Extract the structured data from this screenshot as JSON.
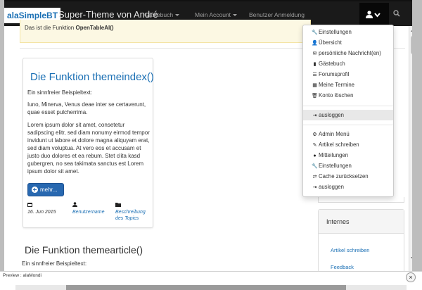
{
  "navbar": {
    "brand_logo": "alaSimpleBT",
    "brand_title": "Super-Theme von André",
    "items": [
      {
        "label": "Gästebuch",
        "has_caret": true
      },
      {
        "label": "Mein Account",
        "has_caret": true
      },
      {
        "label": "Benutzer Anmeldung",
        "has_caret": false
      }
    ],
    "user_icon": "user-icon",
    "search_icon": "search-icon"
  },
  "alert": {
    "prefix": "Das ist die Funktion ",
    "function_name": "OpenTableAl()"
  },
  "card": {
    "title": "Die Funktion themeindex()",
    "intro": "Ein sinnfreier Beispieltext:",
    "para1": "Iuno, Minerva, Venus deae inter se certaverunt, quae esset pulcherrima.",
    "para2": "Lorem ipsum dolor sit amet, consetetur sadipscing elitr, sed diam nonumy eirmod tempor invidunt ut labore et dolore magna aliquyam erat, sed diam voluptua. At vero eos et accusam et justo duo dolores et ea rebum. Stet clita kasd gubergren, no sea takimata sanctus est Lorem ipsum dolor sit amet.",
    "more_button": "mehr...",
    "meta": {
      "date": "16. Jun 2015",
      "author": "Benutzername",
      "topic": "Beschreibung des Topics"
    }
  },
  "section": {
    "title": "Die Funktion themearticle()",
    "subtitle": "Ein sinnfreier Beispieltext:"
  },
  "panel": {
    "title": "Internes",
    "links": [
      "Artikel schreiben",
      "Feedback"
    ]
  },
  "dropdown": {
    "group1": [
      {
        "icon": "wrench-icon",
        "label": "Einstellungen"
      },
      {
        "icon": "user-icon",
        "label": "Übersicht"
      },
      {
        "icon": "envelope-icon",
        "label": "persönliche Nachricht(en)"
      },
      {
        "icon": "book-icon",
        "label": "Gästebuch"
      },
      {
        "icon": "list-alt-icon",
        "label": "Forumsprofil"
      },
      {
        "icon": "calendar-icon",
        "label": "Meine Termine"
      },
      {
        "icon": "trash-icon",
        "label": "Konto löschen"
      }
    ],
    "logout_active": {
      "icon": "logout-icon",
      "label": "ausloggen"
    },
    "group2": [
      {
        "icon": "cog-icon",
        "label": "Admin Menü"
      },
      {
        "icon": "edit-icon",
        "label": "Artikel schreiben"
      },
      {
        "icon": "info-icon",
        "label": "Mitteilungen"
      },
      {
        "icon": "wrench-icon",
        "label": "Einstellungen"
      },
      {
        "icon": "transfer-icon",
        "label": "Cache zurücksetzen"
      },
      {
        "icon": "logout-icon",
        "label": "ausloggen"
      }
    ]
  },
  "status": {
    "preview_label": "Preview : alaMondi",
    "close": "×"
  },
  "colors": {
    "navbar": "#1a1a1a",
    "link": "#1a6fb4",
    "button": "#2868b0",
    "alert_bg": "#fcf8e3"
  }
}
